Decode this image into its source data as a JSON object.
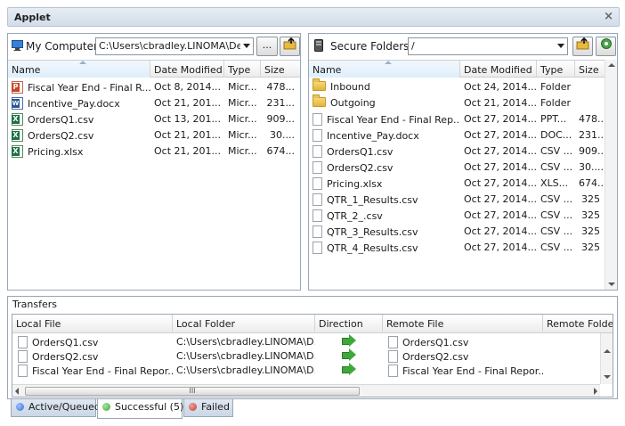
{
  "window": {
    "title": "Applet",
    "close_glyph": "×"
  },
  "local": {
    "label": "My Computer",
    "path": "C:\\Users\\cbradley.LINOMA\\Desk",
    "browse_button": "...",
    "columns": [
      "Name",
      "Date Modified",
      "Type",
      "Size"
    ],
    "files": [
      {
        "icon": "powerpoint-file-icon",
        "name": "Fiscal Year End - Final R...",
        "date": "Oct 8, 2014...",
        "type": "Micr...",
        "size": "478..."
      },
      {
        "icon": "word-file-icon",
        "name": "Incentive_Pay.docx",
        "date": "Oct 21, 201...",
        "type": "Micr...",
        "size": "231..."
      },
      {
        "icon": "excel-file-icon",
        "name": "OrdersQ1.csv",
        "date": "Oct 13, 201...",
        "type": "Micr...",
        "size": "909..."
      },
      {
        "icon": "excel-file-icon",
        "name": "OrdersQ2.csv",
        "date": "Oct 21, 201...",
        "type": "Micr...",
        "size": "30...."
      },
      {
        "icon": "excel-file-icon",
        "name": "Pricing.xlsx",
        "date": "Oct 21, 201...",
        "type": "Micr...",
        "size": "674..."
      }
    ]
  },
  "remote": {
    "label": "Secure Folders",
    "path": "/",
    "columns": [
      "Name",
      "Date Modified",
      "Type",
      "Size"
    ],
    "files": [
      {
        "icon": "folder-icon",
        "name": "Inbound",
        "date": "Oct 24, 2014...",
        "type": "Folder",
        "size": ""
      },
      {
        "icon": "folder-icon",
        "name": "Outgoing",
        "date": "Oct 21, 2014...",
        "type": "Folder",
        "size": ""
      },
      {
        "icon": "file-icon",
        "name": "Fiscal Year End - Final Rep...",
        "date": "Oct 27, 2014...",
        "type": "PPT...",
        "size": "478..."
      },
      {
        "icon": "file-icon",
        "name": "Incentive_Pay.docx",
        "date": "Oct 27, 2014...",
        "type": "DOC...",
        "size": "231..."
      },
      {
        "icon": "file-icon",
        "name": "OrdersQ1.csv",
        "date": "Oct 27, 2014...",
        "type": "CSV ...",
        "size": "909..."
      },
      {
        "icon": "file-icon",
        "name": "OrdersQ2.csv",
        "date": "Oct 27, 2014...",
        "type": "CSV ...",
        "size": "30...."
      },
      {
        "icon": "file-icon",
        "name": "Pricing.xlsx",
        "date": "Oct 27, 2014...",
        "type": "XLS...",
        "size": "674..."
      },
      {
        "icon": "file-icon",
        "name": "QTR_1_Results.csv",
        "date": "Oct 27, 2014...",
        "type": "CSV ...",
        "size": "325"
      },
      {
        "icon": "file-icon",
        "name": "QTR_2_.csv",
        "date": "Oct 27, 2014...",
        "type": "CSV ...",
        "size": "325"
      },
      {
        "icon": "file-icon",
        "name": "QTR_3_Results.csv",
        "date": "Oct 27, 2014...",
        "type": "CSV ...",
        "size": "325"
      },
      {
        "icon": "file-icon",
        "name": "QTR_4_Results.csv",
        "date": "Oct 27, 2014...",
        "type": "CSV ...",
        "size": "325"
      }
    ]
  },
  "transfers": {
    "title": "Transfers",
    "columns": [
      "Local File",
      "Local Folder",
      "Direction",
      "Remote File",
      "Remote Folder"
    ],
    "rows": [
      {
        "local_file": "OrdersQ1.csv",
        "local_folder": "C:\\Users\\cbradley.LINOMA\\D...",
        "direction": "upload-arrow-icon",
        "remote_file": "OrdersQ1.csv"
      },
      {
        "local_file": "OrdersQ2.csv",
        "local_folder": "C:\\Users\\cbradley.LINOMA\\D...",
        "direction": "upload-arrow-icon",
        "remote_file": "OrdersQ2.csv"
      },
      {
        "local_file": "Fiscal Year End - Final Repor...",
        "local_folder": "C:\\Users\\cbradley.LINOMA\\D...",
        "direction": "upload-arrow-icon",
        "remote_file": "Fiscal Year End - Final Repor..."
      }
    ],
    "scroll_grip": "III"
  },
  "tabs": [
    {
      "label": "Active/Queued",
      "dot_color": "#3a6fd8"
    },
    {
      "label": "Successful (5)",
      "dot_color": "#3fa83a"
    },
    {
      "label": "Failed",
      "dot_color": "#c0392b"
    }
  ],
  "colors": {
    "accent": "#dfeefb",
    "border": "#9aa7b6"
  }
}
